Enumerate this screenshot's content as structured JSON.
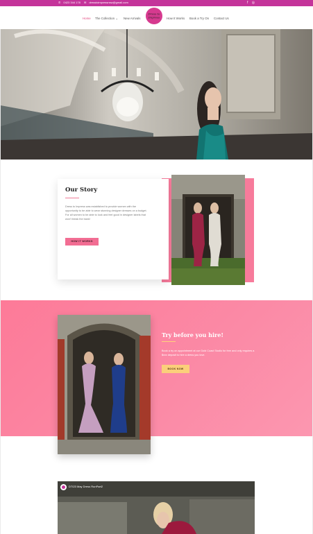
{
  "topbar": {
    "phone": "0423 344 178",
    "email": "dresstoimpressnsw@gmail.com",
    "phone_icon": "phone-icon",
    "email_icon": "envelope-icon",
    "social": [
      "facebook-icon",
      "instagram-icon"
    ],
    "facebook_glyph": "f",
    "instagram_glyph": "◎",
    "phone_glyph": "✆",
    "email_glyph": "✉",
    "color": "#c4349a"
  },
  "nav": {
    "items": [
      {
        "label": "Home"
      },
      {
        "label": "The Collection"
      },
      {
        "label": "New Arrivals"
      },
      {
        "label": "How It Works"
      },
      {
        "label": "Book a Try On"
      },
      {
        "label": "Contact Us"
      }
    ],
    "collection_caret": "⌄",
    "active_color": "#e3457e",
    "logo_text": "Dress to Impress"
  },
  "story": {
    "title": "Our Story",
    "body": "Dress to Impress was established to provide women with the opportunity to be able to wear stunning designer dresses on a budget. For all women to be able to look and feel good in designer labels that won't break the bank!",
    "button": "HOW IT WORKS",
    "accent": "#f77b9b"
  },
  "try": {
    "title": "Try before you hire!",
    "body": "Book a try on appointment at our Gold Coast Studio for free and only requires a $xxx deposit to hire a dress you love.",
    "button": "BOOK NOW",
    "button_color": "#fbcf7a"
  },
  "video": {
    "title": "DTI23 May Dress RunPart2"
  }
}
